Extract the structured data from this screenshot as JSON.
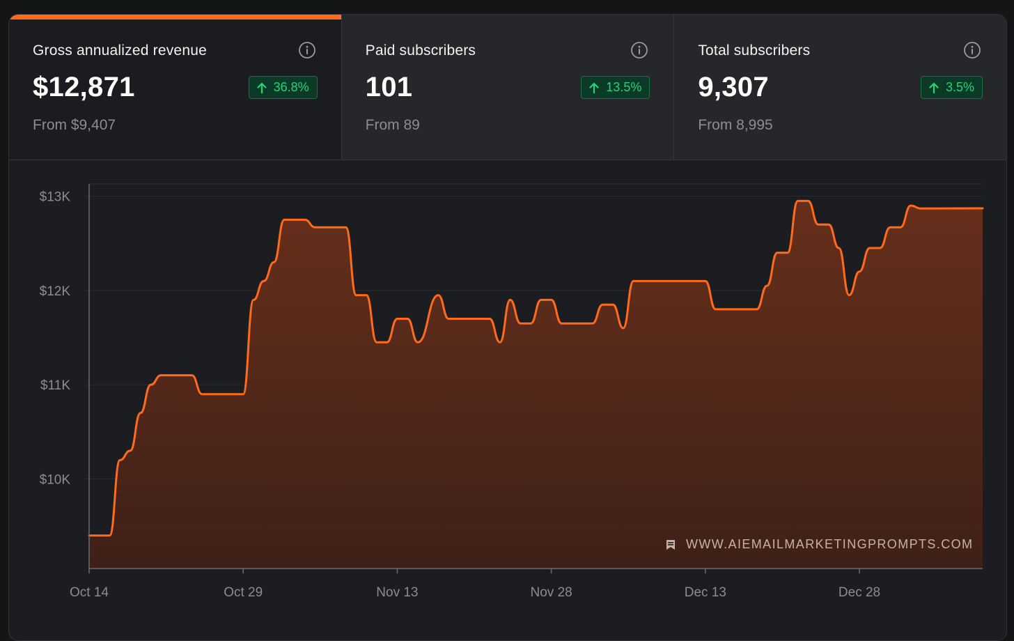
{
  "cards": [
    {
      "title": "Gross annualized revenue",
      "value": "$12,871",
      "change": "36.8%",
      "from": "From $9,407",
      "icon": "info-icon"
    },
    {
      "title": "Paid subscribers",
      "value": "101",
      "change": "13.5%",
      "from": "From 89",
      "icon": "info-icon"
    },
    {
      "title": "Total subscribers",
      "value": "9,307",
      "change": "3.5%",
      "from": "From 8,995",
      "icon": "info-icon"
    }
  ],
  "colors": {
    "accent": "#ff6b1a",
    "positive": "#27d27f",
    "positive_bg": "#0b3a27"
  },
  "watermark": {
    "text": "WWW.AIEMAILMARKETINGPROMPTS.COM",
    "icon": "bookmark-icon"
  },
  "chart_data": {
    "type": "area",
    "title": "",
    "xlabel": "",
    "ylabel": "",
    "y_ticks": [
      "$10K",
      "$11K",
      "$12K",
      "$13K"
    ],
    "x_ticks": [
      "Oct 14",
      "Oct 29",
      "Nov 13",
      "Nov 28",
      "Dec 13",
      "Dec 28"
    ],
    "ylim": [
      9050,
      13130
    ],
    "grid": true,
    "series": [
      {
        "values": [
          [
            "2024-10-14",
            9400
          ],
          [
            "2024-10-16",
            9400
          ],
          [
            "2024-10-17",
            10200
          ],
          [
            "2024-10-18",
            10300
          ],
          [
            "2024-10-19",
            10700
          ],
          [
            "2024-10-20",
            11000
          ],
          [
            "2024-10-21",
            11100
          ],
          [
            "2024-10-23",
            11100
          ],
          [
            "2024-10-24",
            11100
          ],
          [
            "2024-10-25",
            10900
          ],
          [
            "2024-10-29",
            10900
          ],
          [
            "2024-10-30",
            11900
          ],
          [
            "2024-10-31",
            12100
          ],
          [
            "2024-11-01",
            12300
          ],
          [
            "2024-11-02",
            12750
          ],
          [
            "2024-11-04",
            12750
          ],
          [
            "2024-11-05",
            12670
          ],
          [
            "2024-11-08",
            12670
          ],
          [
            "2024-11-09",
            11950
          ],
          [
            "2024-11-10",
            11950
          ],
          [
            "2024-11-11",
            11450
          ],
          [
            "2024-11-12",
            11450
          ],
          [
            "2024-11-13",
            11700
          ],
          [
            "2024-11-14",
            11700
          ],
          [
            "2024-11-15",
            11450
          ],
          [
            "2024-11-17",
            11950
          ],
          [
            "2024-11-18",
            11700
          ],
          [
            "2024-11-22",
            11700
          ],
          [
            "2024-11-23",
            11450
          ],
          [
            "2024-11-24",
            11900
          ],
          [
            "2024-11-25",
            11650
          ],
          [
            "2024-11-26",
            11650
          ],
          [
            "2024-11-27",
            11900
          ],
          [
            "2024-11-28",
            11900
          ],
          [
            "2024-11-29",
            11650
          ],
          [
            "2024-12-01",
            11650
          ],
          [
            "2024-12-02",
            11650
          ],
          [
            "2024-12-03",
            11850
          ],
          [
            "2024-12-04",
            11850
          ],
          [
            "2024-12-05",
            11600
          ],
          [
            "2024-12-06",
            12100
          ],
          [
            "2024-12-13",
            12100
          ],
          [
            "2024-12-14",
            11800
          ],
          [
            "2024-12-18",
            11800
          ],
          [
            "2024-12-19",
            12050
          ],
          [
            "2024-12-20",
            12400
          ],
          [
            "2024-12-21",
            12400
          ],
          [
            "2024-12-22",
            12950
          ],
          [
            "2024-12-23",
            12950
          ],
          [
            "2024-12-24",
            12700
          ],
          [
            "2024-12-25",
            12700
          ],
          [
            "2024-12-26",
            12450
          ],
          [
            "2024-12-27",
            11950
          ],
          [
            "2024-12-28",
            12200
          ],
          [
            "2024-12-29",
            12450
          ],
          [
            "2024-12-30",
            12450
          ],
          [
            "2024-12-31",
            12670
          ],
          [
            "2025-01-01",
            12670
          ],
          [
            "2025-01-02",
            12900
          ],
          [
            "2025-01-03",
            12870
          ],
          [
            "2025-01-09",
            12871
          ]
        ]
      }
    ]
  }
}
